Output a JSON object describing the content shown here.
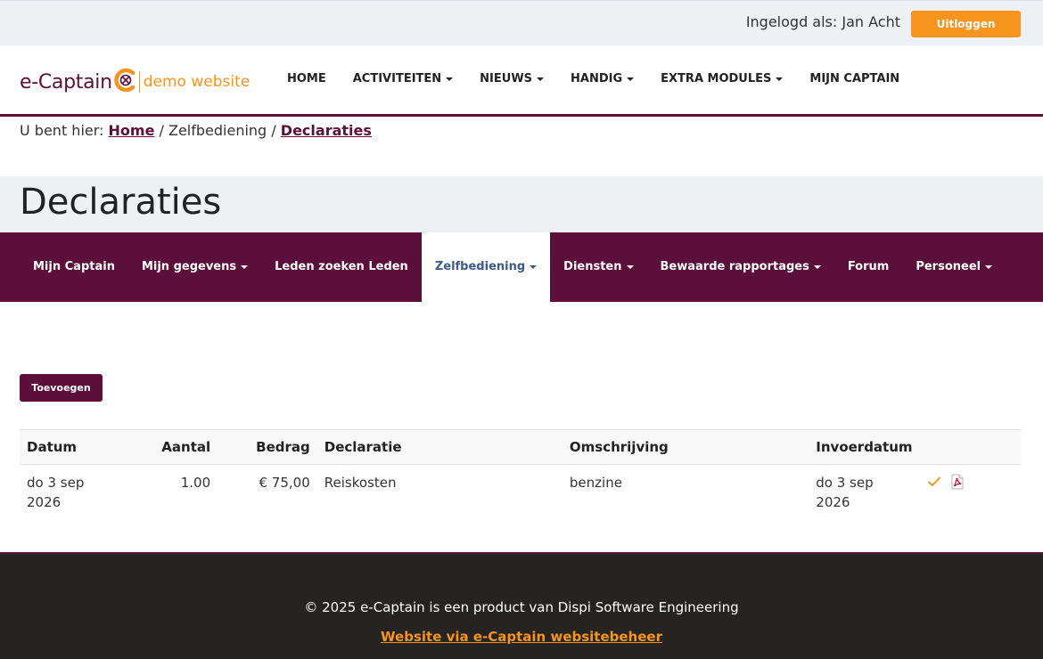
{
  "topbar": {
    "login_text": "Ingelogd als: Jan Acht",
    "logout_label": "Uitloggen"
  },
  "logo": {
    "brand": "e-Captain",
    "tagline": "demo website"
  },
  "main_nav": [
    {
      "label": "HOME",
      "dropdown": false
    },
    {
      "label": "ACTIVITEITEN",
      "dropdown": true
    },
    {
      "label": "NIEUWS",
      "dropdown": true
    },
    {
      "label": "HANDIG",
      "dropdown": true
    },
    {
      "label": "EXTRA MODULES",
      "dropdown": true
    },
    {
      "label": "MIJN CAPTAIN",
      "dropdown": false
    }
  ],
  "breadcrumb": {
    "prefix": "U bent hier:",
    "home": "Home",
    "sep": "/",
    "middle": "Zelfbediening",
    "current": "Declaraties"
  },
  "page_title": "Declaraties",
  "sub_nav": [
    {
      "label": "Mijn Captain",
      "dropdown": false,
      "active": false
    },
    {
      "label": "Mijn gegevens",
      "dropdown": true,
      "active": false
    },
    {
      "label": "Leden zoeken Leden",
      "dropdown": false,
      "active": false
    },
    {
      "label": "Zelfbediening",
      "dropdown": true,
      "active": true
    },
    {
      "label": "Diensten",
      "dropdown": true,
      "active": false
    },
    {
      "label": "Bewaarde rapportages",
      "dropdown": true,
      "active": false
    },
    {
      "label": "Forum",
      "dropdown": false,
      "active": false
    },
    {
      "label": "Personeel",
      "dropdown": true,
      "active": false
    }
  ],
  "add_button": "Toevoegen",
  "table": {
    "headers": {
      "datum": "Datum",
      "aantal": "Aantal",
      "bedrag": "Bedrag",
      "declaratie": "Declaratie",
      "omschrijving": "Omschrijving",
      "invoerdatum": "Invoerdatum"
    },
    "rows": [
      {
        "datum_line1": "do 3 sep",
        "datum_line2": "2026",
        "aantal": "1.00",
        "bedrag": "€ 75,00",
        "declaratie": "Reiskosten",
        "omschrijving": "benzine",
        "invoer_line1": "do 3 sep",
        "invoer_line2": "2026",
        "icons": [
          "check-icon",
          "pdf-icon"
        ]
      }
    ]
  },
  "footer": {
    "copyright": "© 2025 e-Captain is een product van Dispi Software Engineering",
    "link": "Website via e-Captain websitebeheer"
  },
  "colors": {
    "primary": "#5b0f3a",
    "accent": "#f7941d",
    "light_bg": "#edf1f4",
    "footer_bg": "#252422",
    "active_tab_text": "#3d5a8a"
  }
}
